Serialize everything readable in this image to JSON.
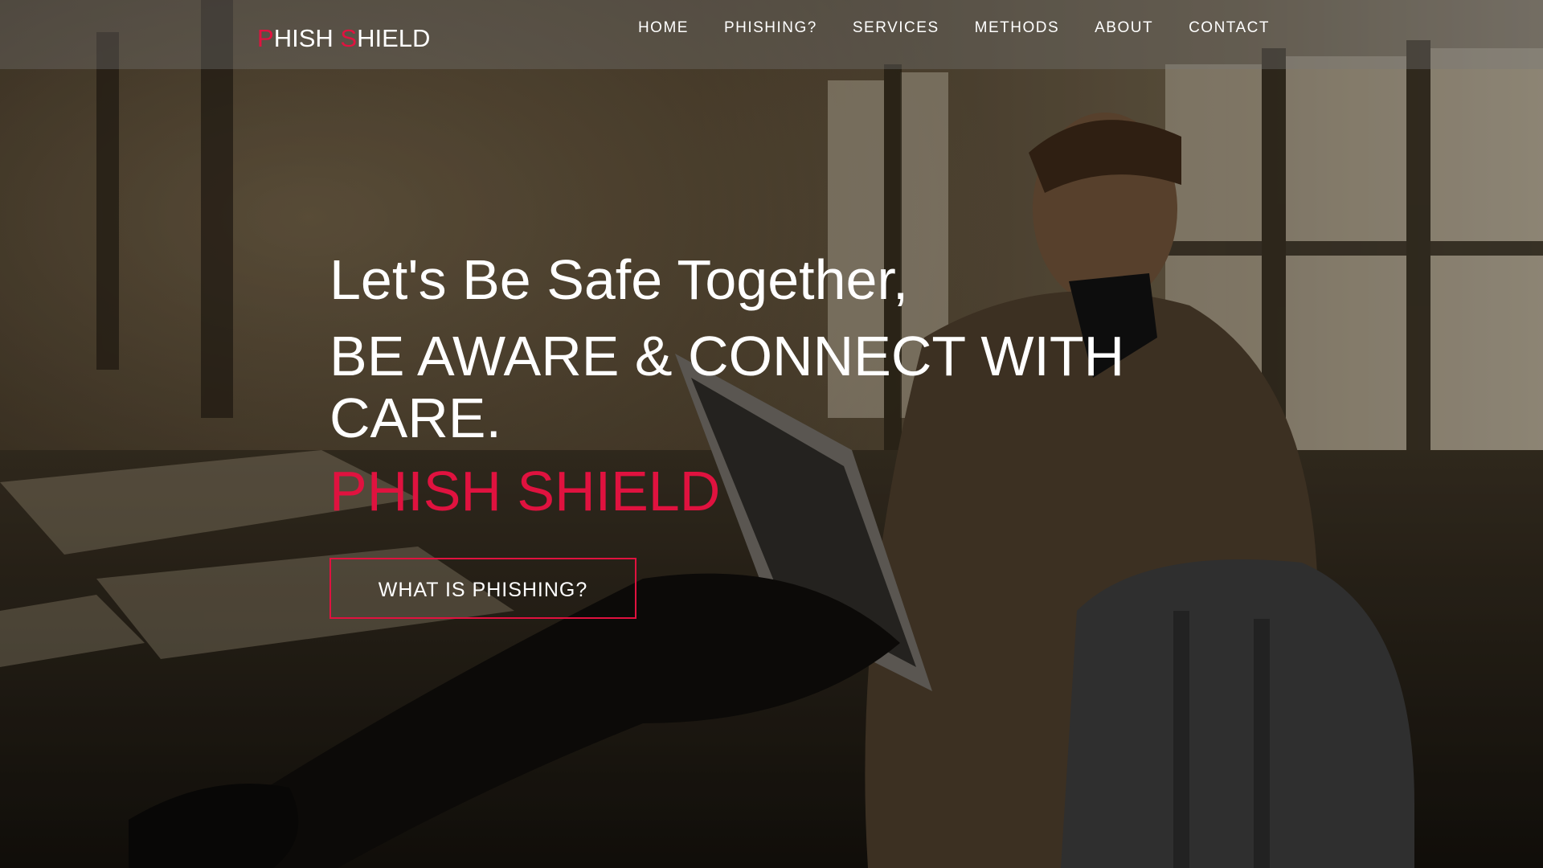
{
  "brand": {
    "first_letter": "P",
    "first_rest": "HISH ",
    "second_letter": "S",
    "second_rest": "HIELD"
  },
  "nav": {
    "items": [
      {
        "label": "HOME"
      },
      {
        "label": "PHISHING?"
      },
      {
        "label": "SERVICES"
      },
      {
        "label": "METHODS"
      },
      {
        "label": "ABOUT"
      },
      {
        "label": "CONTACT"
      }
    ]
  },
  "hero": {
    "tagline": "Let's Be Safe Together,",
    "headline": "BE AWARE & CONNECT WITH CARE.",
    "brand_name": "PHISH SHIELD",
    "cta_label": "WHAT IS PHISHING?"
  },
  "colors": {
    "accent": "#e0123f",
    "text": "#ffffff",
    "navbar_bg": "rgba(120,120,120,0.35)"
  }
}
